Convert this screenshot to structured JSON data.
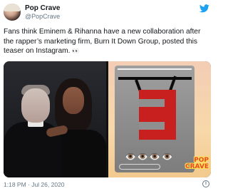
{
  "author": {
    "display_name": "Pop Crave",
    "handle": "@PopCrave"
  },
  "tweet": {
    "text": "Fans think Eminem & Rihanna have a new collaboration after the rapper’s marketing firm, Burn It Down Group, posted this teaser on Instagram.",
    "emoji": "👀"
  },
  "media": {
    "story_emoji": "👁️👁️👁️👁️",
    "brand_badge_line1": "POP",
    "brand_badge_line2": "CRAVE"
  },
  "footer": {
    "timestamp": "1:18 PM · Jul 26, 2020",
    "info_label": "i"
  },
  "colors": {
    "brand_bird": "#1da1f2",
    "logo_red": "#c8201f",
    "logo_black": "#0c0c0c"
  }
}
